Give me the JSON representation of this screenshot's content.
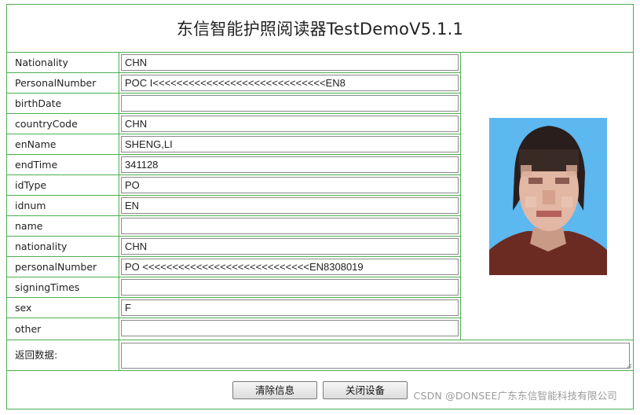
{
  "app": {
    "title": "东信智能护照阅读器TestDemoV5.1.1"
  },
  "fields": [
    {
      "label": "Nationality",
      "value": "CHN"
    },
    {
      "label": "PersonalNumber",
      "value": "POC       I<<<<<<<<<<<<<<<<<<<<<<<<<<<<<EN8"
    },
    {
      "label": "birthDate",
      "value": ""
    },
    {
      "label": "countryCode",
      "value": "CHN"
    },
    {
      "label": "enName",
      "value": "SHENG,LI"
    },
    {
      "label": "endTime",
      "value": "341128"
    },
    {
      "label": "idType",
      "value": "PO"
    },
    {
      "label": "idnum",
      "value": "EN"
    },
    {
      "label": "name",
      "value": ""
    },
    {
      "label": "nationality",
      "value": "CHN"
    },
    {
      "label": "personalNumber",
      "value": "PO           <<<<<<<<<<<<<<<<<<<<<<<<<<<<EN8308019"
    },
    {
      "label": "signingTimes",
      "value": ""
    },
    {
      "label": "sex",
      "value": "F"
    },
    {
      "label": "other",
      "value": ""
    }
  ],
  "return_data": {
    "label": "返回数据:",
    "value": ""
  },
  "buttons": {
    "clear_label": "清除信息",
    "close_label": "关闭设备"
  },
  "watermark": "CSDN @DONSEE广东东信智能科技有限公司",
  "colors": {
    "border": "#4caf50",
    "photo_bg": "#5cb8ef"
  },
  "icons": {
    "photo": "portrait-photo",
    "grip": "resize-grip-icon"
  }
}
